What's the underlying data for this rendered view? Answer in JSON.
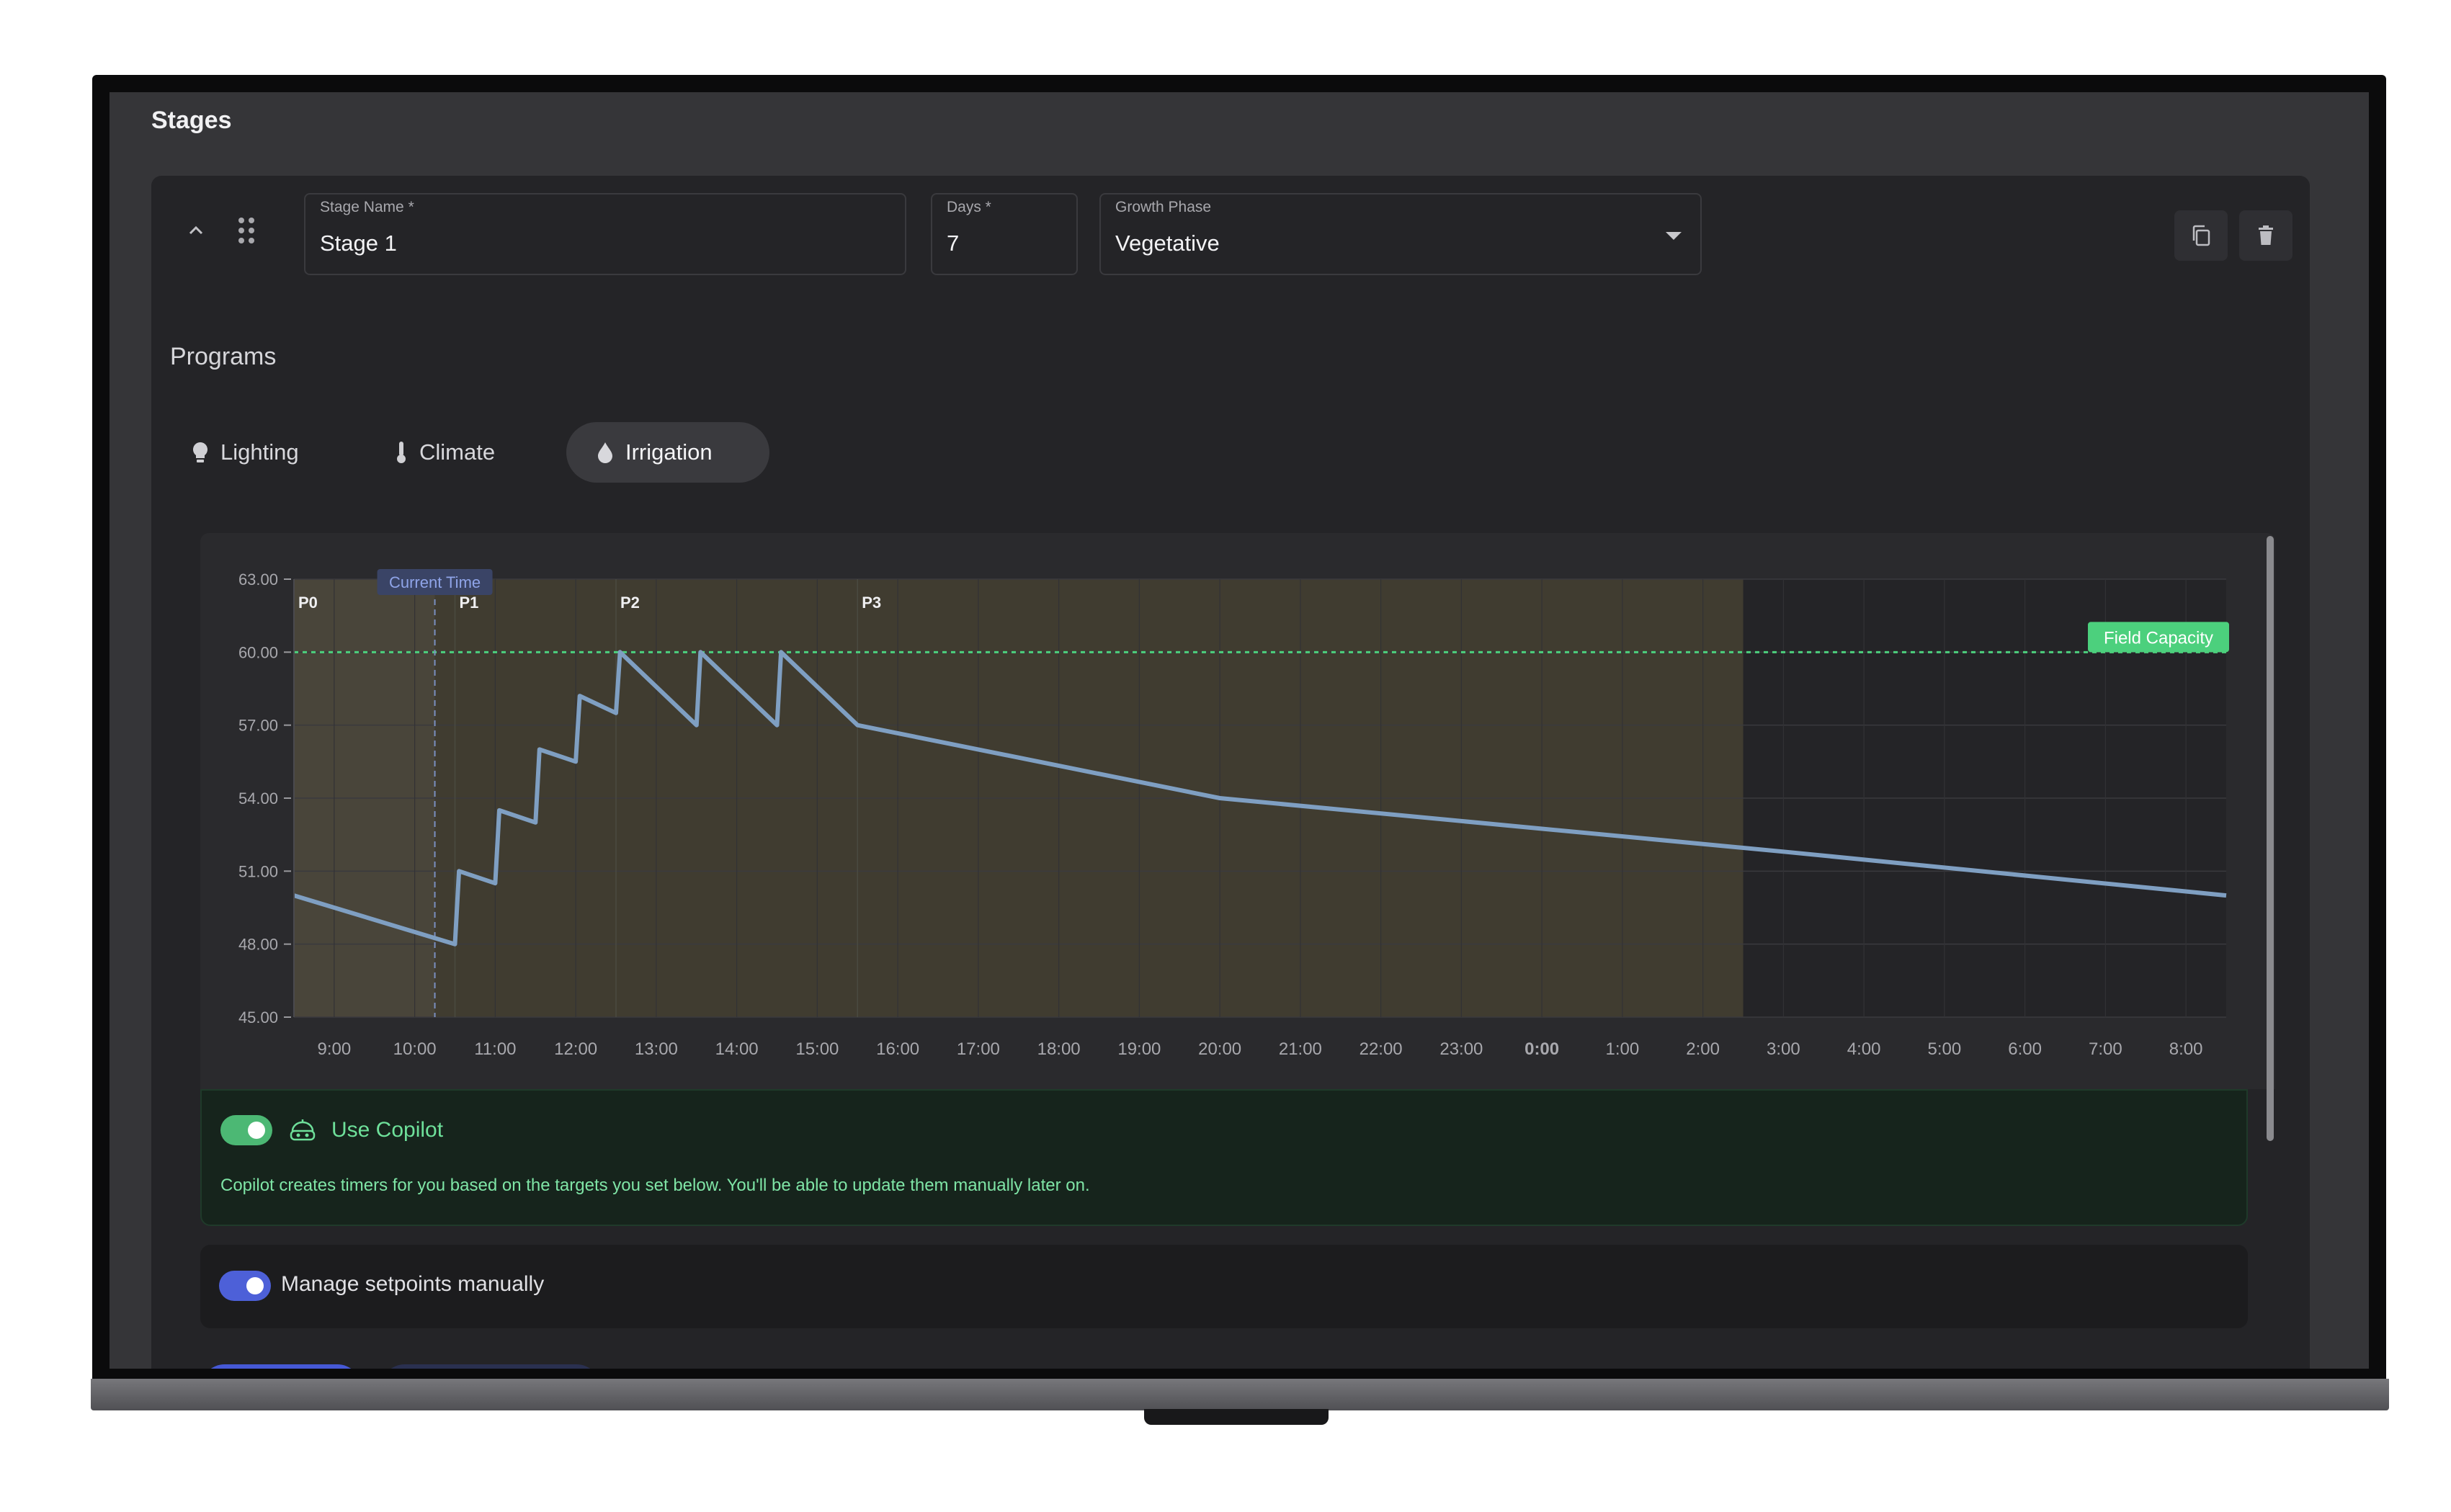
{
  "header": {
    "title": "Stages"
  },
  "stage": {
    "name_label": "Stage Name *",
    "name_value": "Stage 1",
    "days_label": "Days *",
    "days_value": "7",
    "phase_label": "Growth Phase",
    "phase_value": "Vegetative"
  },
  "programs": {
    "title": "Programs",
    "tabs": [
      {
        "label": "Lighting",
        "icon": "bulb-icon"
      },
      {
        "label": "Climate",
        "icon": "thermometer-icon"
      },
      {
        "label": "Irrigation",
        "icon": "droplet-icon",
        "active": true
      }
    ]
  },
  "chart_data": {
    "type": "line",
    "ylim": [
      45,
      63
    ],
    "yticks": [
      "63.00",
      "60.00",
      "57.00",
      "54.00",
      "51.00",
      "48.00",
      "45.00"
    ],
    "xticks": [
      "9:00",
      "10:00",
      "11:00",
      "12:00",
      "13:00",
      "14:00",
      "15:00",
      "16:00",
      "17:00",
      "18:00",
      "19:00",
      "20:00",
      "21:00",
      "22:00",
      "23:00",
      "0:00",
      "1:00",
      "2:00",
      "3:00",
      "4:00",
      "5:00",
      "6:00",
      "7:00",
      "8:00"
    ],
    "points": [
      [
        8.5,
        50.0
      ],
      [
        10.5,
        48.0
      ],
      [
        10.55,
        51.0
      ],
      [
        11.0,
        50.5
      ],
      [
        11.05,
        53.5
      ],
      [
        11.5,
        53.0
      ],
      [
        11.55,
        56.0
      ],
      [
        12.0,
        55.5
      ],
      [
        12.05,
        58.2
      ],
      [
        12.5,
        57.5
      ],
      [
        12.55,
        60.0
      ],
      [
        13.5,
        57.0
      ],
      [
        13.55,
        60.0
      ],
      [
        14.5,
        57.0
      ],
      [
        14.55,
        60.0
      ],
      [
        15.5,
        57.0
      ],
      [
        20.0,
        54.0
      ],
      [
        27.0,
        51.8
      ],
      [
        32.5,
        50.0
      ]
    ],
    "field_capacity": {
      "label": "Field Capacity",
      "value": 60
    },
    "current_time": {
      "label": "Current Time",
      "x": 10.25
    },
    "phases": [
      {
        "label": "P0",
        "x": 8.5
      },
      {
        "label": "P1",
        "x": 10.5
      },
      {
        "label": "P2",
        "x": 12.5
      },
      {
        "label": "P3",
        "x": 15.5
      }
    ],
    "shaded_end": 26.5,
    "colors": {
      "line": "#7f9fc2",
      "field_capacity": "#4cd07d",
      "shade": "#403c30",
      "current_time": "#7a8fc0"
    }
  },
  "copilot": {
    "title": "Use Copilot",
    "description": "Copilot creates timers for you based on the targets you set below. You'll be able to update them manually later on.",
    "enabled": true
  },
  "manual": {
    "label": "Manage setpoints manually",
    "enabled": true
  }
}
